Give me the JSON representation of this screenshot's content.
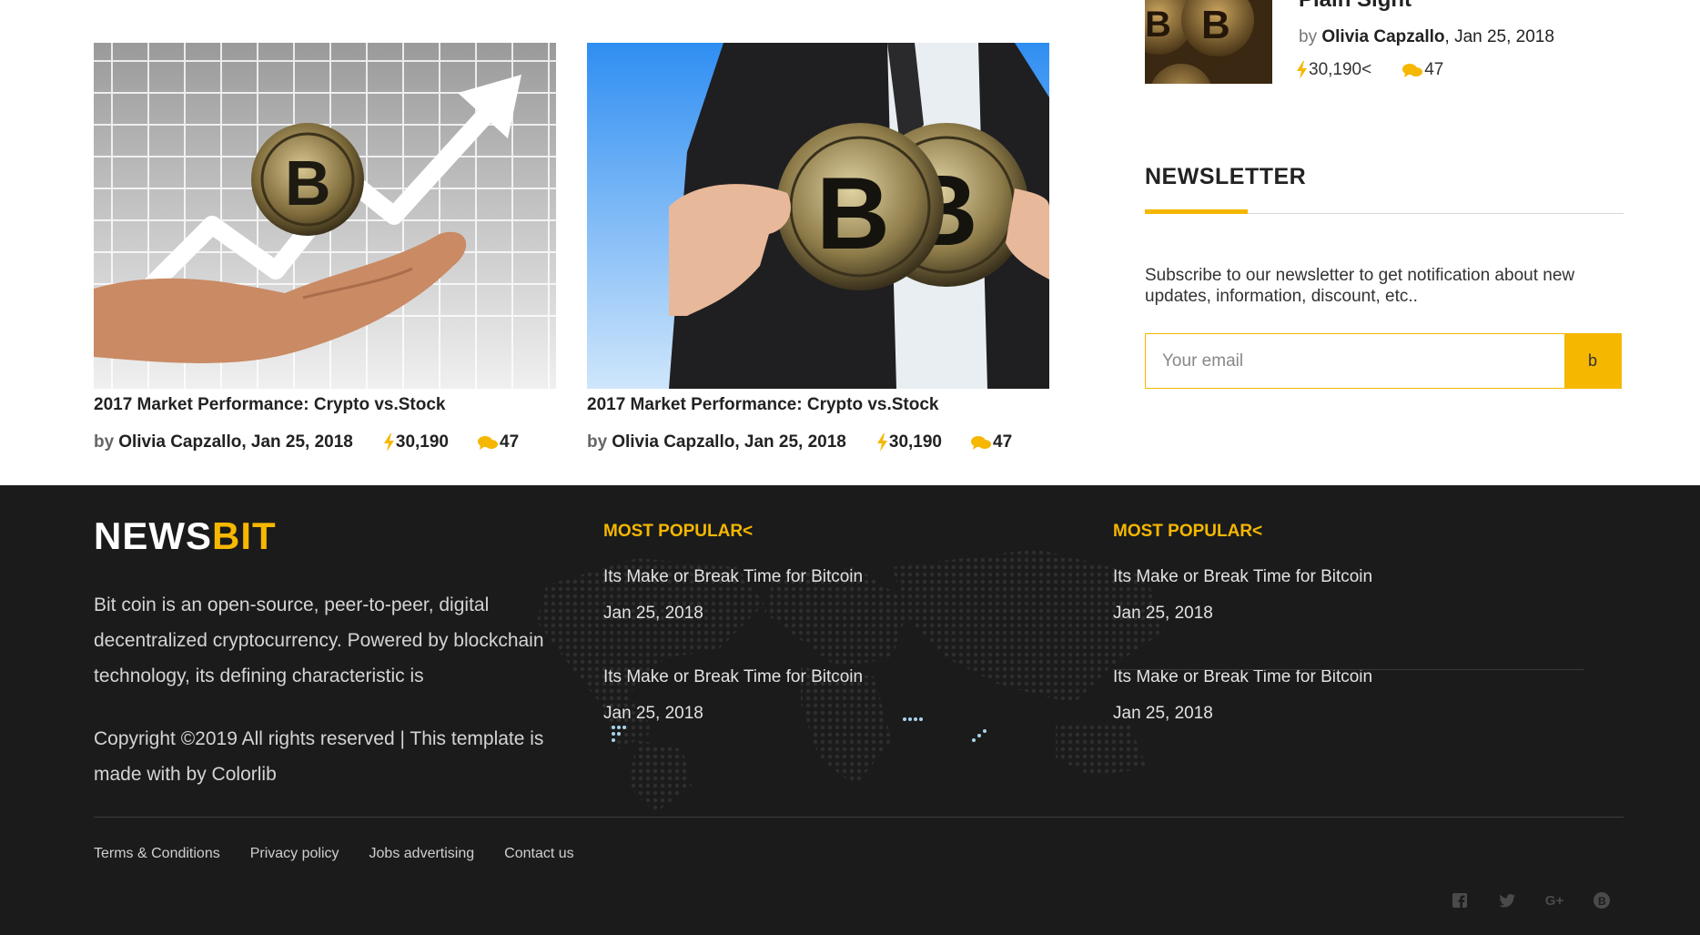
{
  "articles": [
    {
      "title": "2017 Market Performance: Crypto vs.Stock",
      "by": "by",
      "author_date": "Olivia Capzallo, Jan 25, 2018",
      "views": "30,190",
      "comments": "47",
      "image": "hand-holding-bitcoin-with-rising-arrow"
    },
    {
      "title": "2017 Market Performance: Crypto vs.Stock",
      "by": "by",
      "author_date": "Olivia Capzallo, Jan 25, 2018",
      "views": "30,190",
      "comments": "47",
      "image": "businessman-holding-two-bitcoins"
    }
  ],
  "sidebar": {
    "partial_title": "Plain Sight",
    "by": "by",
    "author": "Olivia Capzallo",
    "date": ", Jan 25, 2018",
    "views": "30,190<",
    "comments": "47"
  },
  "newsletter": {
    "heading": "NEWSLETTER",
    "text": "Subscribe to our newsletter to get notification about new updates, information, discount, etc..",
    "placeholder": "Your email",
    "submit_label": "b"
  },
  "footer": {
    "logo_a": "NEWS",
    "logo_b": "BIT",
    "about": "Bit coin is an open-source, peer-to-peer, digital decentralized cryptocurrency. Powered by blockchain technology, its defining characteristic is",
    "copyright": "Copyright ©2019 All rights reserved | This template is made with by Colorlib",
    "popular": [
      {
        "heading": "MOST POPULAR<",
        "items": [
          {
            "title": "Its Make or Break Time for Bitcoin",
            "date": "Jan 25, 2018"
          },
          {
            "title": "Its Make or Break Time for Bitcoin",
            "date": "Jan 25, 2018"
          }
        ]
      },
      {
        "heading": "MOST POPULAR<",
        "items": [
          {
            "title": "Its Make or Break Time for Bitcoin",
            "date": "Jan 25, 2018"
          },
          {
            "title": "Its Make or Break Time for Bitcoin",
            "date": "Jan 25, 2018"
          }
        ]
      }
    ],
    "links": [
      "Terms & Conditions",
      "Privacy policy",
      "Jobs advertising",
      "Contact us"
    ],
    "social_icons": [
      "facebook-icon",
      "twitter-icon",
      "google-plus-icon",
      "bitcoin-icon"
    ]
  },
  "colors": {
    "accent": "#f5b700",
    "footer_bg": "#1b1b1b"
  }
}
